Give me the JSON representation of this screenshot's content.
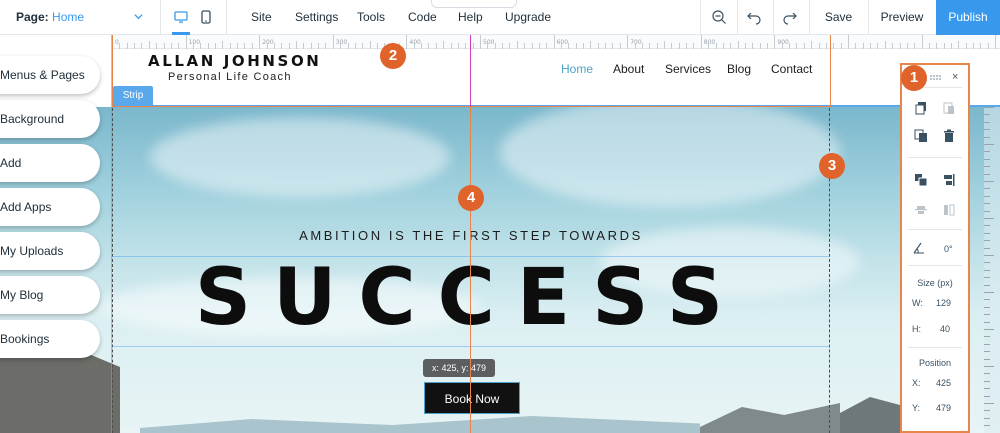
{
  "topbar": {
    "page_label": "Page:",
    "page_value": "Home",
    "menu": [
      "Site",
      "Settings",
      "Tools",
      "Code",
      "Help",
      "Upgrade"
    ],
    "save_label": "Save",
    "preview_label": "Preview",
    "publish_label": "Publish",
    "collapse_icon": "^"
  },
  "ruler": {
    "numbers": [
      "0",
      "100",
      "200",
      "300",
      "400",
      "500",
      "600",
      "700",
      "800",
      "900"
    ]
  },
  "site": {
    "logo_name": "ALLAN JOHNSON",
    "logo_sub": "Personal Life Coach",
    "nav": [
      "Home",
      "About",
      "Services",
      "Blog",
      "Contact"
    ],
    "active_nav": "Home",
    "strip_label": "Strip",
    "tagline": "AMBITION IS THE FIRST STEP TOWARDS",
    "headline": "SUCCESS",
    "coord_tooltip": "x: 425, y: 479",
    "cta_label": "Book Now"
  },
  "left_panel": {
    "items": [
      "Menus & Pages",
      "Background",
      "Add",
      "Add Apps",
      "My Uploads",
      "My Blog",
      "Bookings"
    ]
  },
  "right_toolbar": {
    "close_icon": "×",
    "rotation_value": "0°",
    "size_heading": "Size (px)",
    "w_label": "W:",
    "w_value": "129",
    "h_label": "H:",
    "h_value": "40",
    "position_heading": "Position",
    "x_label": "X:",
    "x_value": "425",
    "y_label": "Y:",
    "y_value": "479"
  },
  "markers": [
    "1",
    "2",
    "3",
    "4"
  ],
  "colors": {
    "accent": "#3899ec",
    "marker": "#e0632b",
    "guide_pink": "#d23fbd",
    "guide_orange": "#e8854a"
  }
}
